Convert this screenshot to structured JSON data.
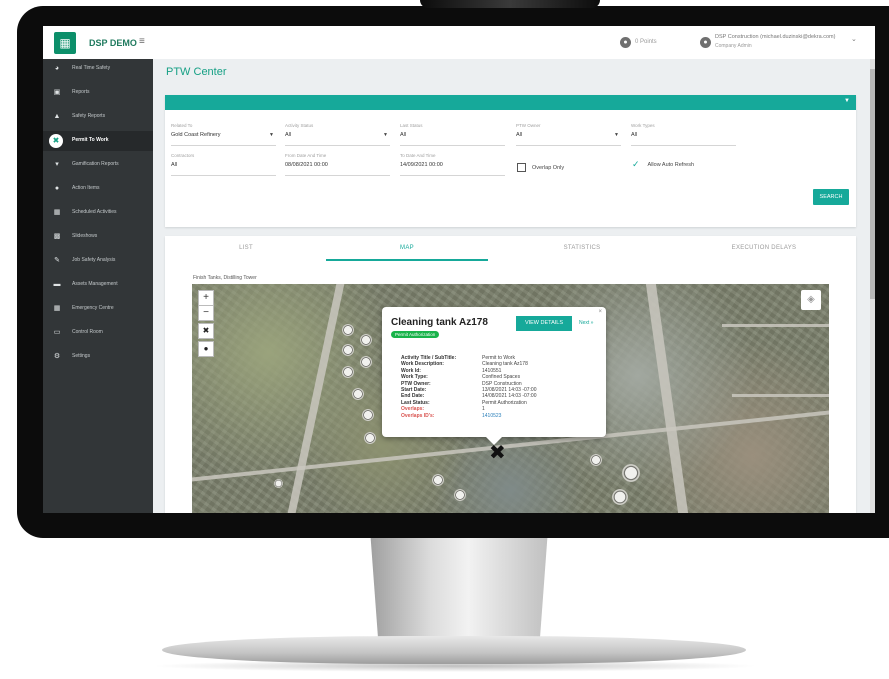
{
  "app": {
    "name": "DSP DEMO",
    "points": "0 Points",
    "user_name": "DSP Construction (michael.duzinski@dekra.com)",
    "user_role": "Company Admin"
  },
  "sidebar": {
    "items": [
      {
        "label": "Real Time Safety",
        "icon": "pie-chart-icon"
      },
      {
        "label": "Reports",
        "icon": "clipboard-icon"
      },
      {
        "label": "Safety Reports",
        "icon": "warning-icon"
      },
      {
        "label": "Permit To Work",
        "icon": "tools-icon"
      },
      {
        "label": "Gamification Reports",
        "icon": "trophy-icon"
      },
      {
        "label": "Action Items",
        "icon": "info-icon"
      },
      {
        "label": "Scheduled Activities",
        "icon": "calendar-icon"
      },
      {
        "label": "Slideshows",
        "icon": "slides-icon"
      },
      {
        "label": "Job Safety Analysis",
        "icon": "edit-icon"
      },
      {
        "label": "Assets Management",
        "icon": "car-icon"
      },
      {
        "label": "Emergency Centre",
        "icon": "network-icon"
      },
      {
        "label": "Control Room",
        "icon": "monitor-icon"
      },
      {
        "label": "Settings",
        "icon": "gear-icon"
      }
    ]
  },
  "page": {
    "title": "PTW Center"
  },
  "filters": {
    "related_to": {
      "label": "Related To",
      "value": "Gold Coast Refinery"
    },
    "activity_status": {
      "label": "Activity Status",
      "value": "All"
    },
    "last_status": {
      "label": "Last Status",
      "value": "All"
    },
    "ptw_owner": {
      "label": "PTW Owner",
      "value": "All"
    },
    "work_types": {
      "label": "Work Types",
      "value": "All"
    },
    "contractors": {
      "label": "Contractors",
      "value": "All"
    },
    "from_date": {
      "label": "From Date And Time",
      "value": "08/08/2021 00:00"
    },
    "to_date": {
      "label": "To Date And Time",
      "value": "14/09/2021 00:00"
    },
    "overlap_only": "Overlap Only",
    "auto_refresh": "Allow Auto Refresh",
    "search_label": "SEARCH"
  },
  "tabs": [
    {
      "label": "LIST"
    },
    {
      "label": "MAP"
    },
    {
      "label": "STATISTICS"
    },
    {
      "label": "EXECUTION DELAYS"
    }
  ],
  "map": {
    "caption": "Finish Tanks, Distilling Tower",
    "zoom_in": "+",
    "zoom_out": "−"
  },
  "popup": {
    "title": "Cleaning tank Az178",
    "badge": "Permit Authorization",
    "view_details": "VIEW DETAILS",
    "next": "Next »",
    "close": "×",
    "rows": [
      {
        "k": "Activity Title / SubTitle:",
        "v": "Permit to Work"
      },
      {
        "k": "Work Description:",
        "v": "Cleaning tank Az178"
      },
      {
        "k": "Work Id:",
        "v": "1410551"
      },
      {
        "k": "Work Type:",
        "v": "Confined Spaces"
      },
      {
        "k": "PTW Owner:",
        "v": "DSP Construction"
      },
      {
        "k": "Start Date:",
        "v": "13/08/2021 14:03 -07:00"
      },
      {
        "k": "End Date:",
        "v": "14/08/2021 14:03 -07:00"
      },
      {
        "k": "Last Status:",
        "v": "Permit Authorization"
      },
      {
        "k": "Overlaps:",
        "v": "1"
      },
      {
        "k": "Overlaps ID's:",
        "v": "1410523"
      }
    ]
  },
  "colors": {
    "accent": "#16a99a",
    "sidebar": "#323638",
    "badge_green": "#19b34a",
    "warn": "#d9534f"
  }
}
